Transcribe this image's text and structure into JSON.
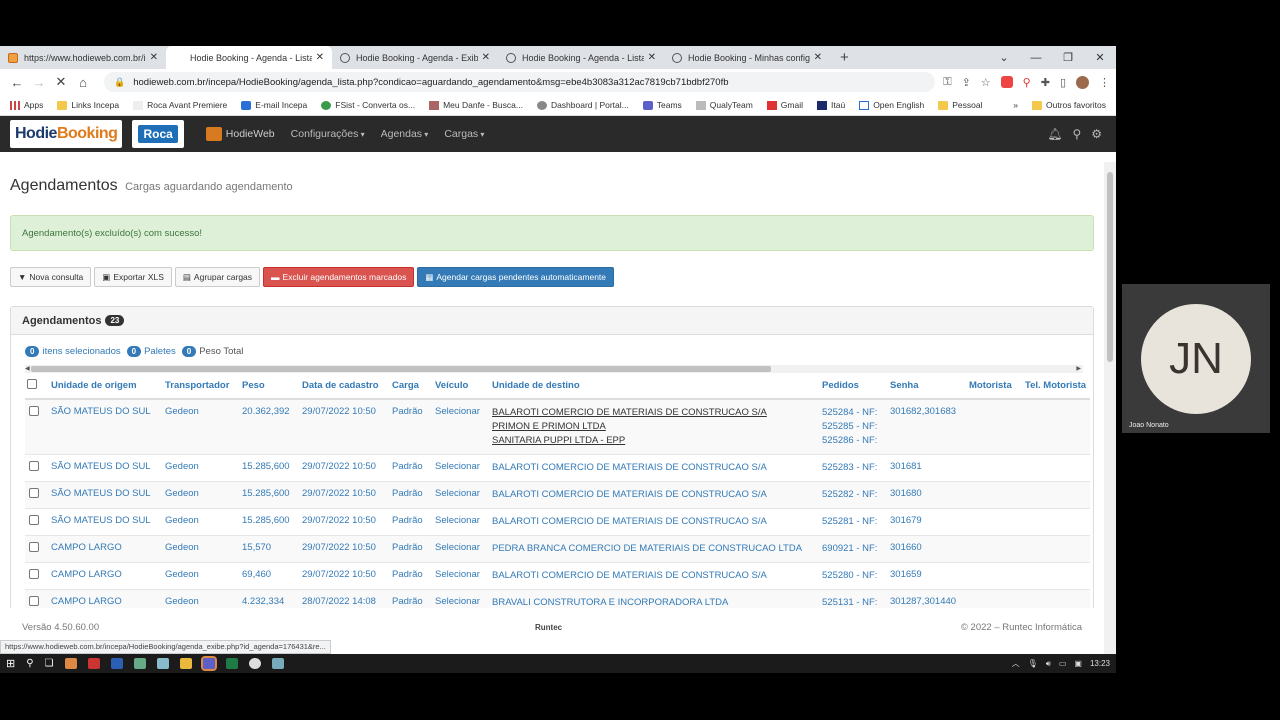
{
  "browser": {
    "tabs": [
      {
        "title": "https://www.hodieweb.com.br/in",
        "active": false
      },
      {
        "title": "Hodie Booking - Agenda - Lista",
        "active": true
      },
      {
        "title": "Hodie Booking - Agenda - Exibiç",
        "active": false
      },
      {
        "title": "Hodie Booking - Agenda - Lista",
        "active": false
      },
      {
        "title": "Hodie Booking - Minhas configu",
        "active": false
      }
    ],
    "url": "hodieweb.com.br/incepa/HodieBooking/agenda_lista.php?condicao=aguardando_agendamento&msg=ebe4b3083a312ac7819cb71bdbf270fb",
    "bookmarks": [
      {
        "label": "Apps",
        "icon": "apps-grid-icon"
      },
      {
        "label": "Links Incepa",
        "icon": "folder-icon"
      },
      {
        "label": "Roca Avant Premiere",
        "icon": "page-icon"
      },
      {
        "label": "E-mail Incepa",
        "icon": "outlook-icon"
      },
      {
        "label": "FSist - Converta os...",
        "icon": "fsist-icon"
      },
      {
        "label": "Meu Danfe - Busca...",
        "icon": "danfe-icon"
      },
      {
        "label": "Dashboard | Portal...",
        "icon": "dashboard-icon"
      },
      {
        "label": "Teams",
        "icon": "teams-icon"
      },
      {
        "label": "QualyTeam",
        "icon": "qualyteam-icon"
      },
      {
        "label": "Gmail",
        "icon": "gmail-icon"
      },
      {
        "label": "Itaú",
        "icon": "itau-icon"
      },
      {
        "label": "Open English",
        "icon": "open-english-icon"
      },
      {
        "label": "Pessoal",
        "icon": "folder-icon"
      }
    ],
    "other_bookmarks": "Outros favoritos",
    "status_url": "https://www.hodieweb.com.br/incepa/HodieBooking/agenda_exibe.php?id_agenda=176431&re..."
  },
  "app": {
    "logo_text_a": "Hodie",
    "logo_text_b": "Booking",
    "roca": "Roca",
    "hodieweb": "HodieWeb",
    "menus": [
      "Configurações",
      "Agendas",
      "Cargas"
    ]
  },
  "page": {
    "title": "Agendamentos",
    "subtitle": "Cargas aguardando agendamento",
    "alert": "Agendamento(s) excluído(s) com sucesso!",
    "buttons": {
      "nova_consulta": "Nova consulta",
      "exportar": "Exportar XLS",
      "agrupar": "Agrupar cargas",
      "excluir": "Excluir agendamentos marcados",
      "agendar": "Agendar cargas pendentes automaticamente"
    },
    "panel_title": "Agendamentos",
    "panel_count": "23",
    "stats": {
      "itens_count": "0",
      "itens_label": "itens selecionados",
      "paletes_count": "0",
      "paletes_label": "Paletes",
      "peso_count": "0",
      "peso_label": "Peso Total"
    },
    "columns": [
      "Unidade de origem",
      "Transportador",
      "Peso",
      "Data de cadastro",
      "Carga",
      "Veículo",
      "Unidade de destino",
      "Pedidos",
      "Senha",
      "Motorista",
      "Tel. Motorista"
    ],
    "rows": [
      {
        "origem": "SÃO MATEUS DO SUL",
        "transp": "Gedeon",
        "peso": "20.362,392",
        "data": "29/07/2022 10:50",
        "carga": "Padrão",
        "veiculo": "Selecionar",
        "destino": [
          "BALAROTI COMERCIO DE MATERIAIS DE CONSTRUCAO S/A",
          "PRIMON E PRIMON LTDA",
          "SANITARIA PUPPI LTDA - EPP"
        ],
        "pedidos": [
          "525284 - NF:",
          "525285 - NF:",
          "525286 - NF:"
        ],
        "senha": "301682,301683"
      },
      {
        "origem": "SÃO MATEUS DO SUL",
        "transp": "Gedeon",
        "peso": "15.285,600",
        "data": "29/07/2022 10:50",
        "carga": "Padrão",
        "veiculo": "Selecionar",
        "destino": [
          "BALAROTI COMERCIO DE MATERIAIS DE CONSTRUCAO S/A"
        ],
        "pedidos": [
          "525283 - NF:"
        ],
        "senha": "301681"
      },
      {
        "origem": "SÃO MATEUS DO SUL",
        "transp": "Gedeon",
        "peso": "15.285,600",
        "data": "29/07/2022 10:50",
        "carga": "Padrão",
        "veiculo": "Selecionar",
        "destino": [
          "BALAROTI COMERCIO DE MATERIAIS DE CONSTRUCAO S/A"
        ],
        "pedidos": [
          "525282 - NF:"
        ],
        "senha": "301680"
      },
      {
        "origem": "SÃO MATEUS DO SUL",
        "transp": "Gedeon",
        "peso": "15.285,600",
        "data": "29/07/2022 10:50",
        "carga": "Padrão",
        "veiculo": "Selecionar",
        "destino": [
          "BALAROTI COMERCIO DE MATERIAIS DE CONSTRUCAO S/A"
        ],
        "pedidos": [
          "525281 - NF:"
        ],
        "senha": "301679"
      },
      {
        "origem": "CAMPO LARGO",
        "transp": "Gedeon",
        "peso": "15,570",
        "data": "29/07/2022 10:50",
        "carga": "Padrão",
        "veiculo": "Selecionar",
        "destino": [
          "PEDRA BRANCA COMERCIO DE MATERIAIS DE CONSTRUCAO LTDA"
        ],
        "pedidos": [
          "690921 - NF:"
        ],
        "senha": "301660"
      },
      {
        "origem": "CAMPO LARGO",
        "transp": "Gedeon",
        "peso": "69,460",
        "data": "29/07/2022 10:50",
        "carga": "Padrão",
        "veiculo": "Selecionar",
        "destino": [
          "BALAROTI COMERCIO DE MATERIAIS DE CONSTRUCAO S/A"
        ],
        "pedidos": [
          "525280 - NF:"
        ],
        "senha": "301659"
      },
      {
        "origem": "CAMPO LARGO",
        "transp": "Gedeon",
        "peso": "4.232,334",
        "data": "28/07/2022 14:08",
        "carga": "Padrão",
        "veiculo": "Selecionar",
        "destino": [
          "BRAVALI CONSTRUTORA E INCORPORADORA LTDA"
        ],
        "pedidos": [
          "525131 - NF:"
        ],
        "senha": "301287,301440"
      }
    ],
    "footer_version": "Versão 4.50.60.00",
    "footer_brand": "Runtec",
    "footer_copy": "© 2022 – Runtec Informática"
  },
  "taskbar": {
    "time": "13:23"
  },
  "video": {
    "initials": "JN",
    "name": "Joao Nonato"
  }
}
